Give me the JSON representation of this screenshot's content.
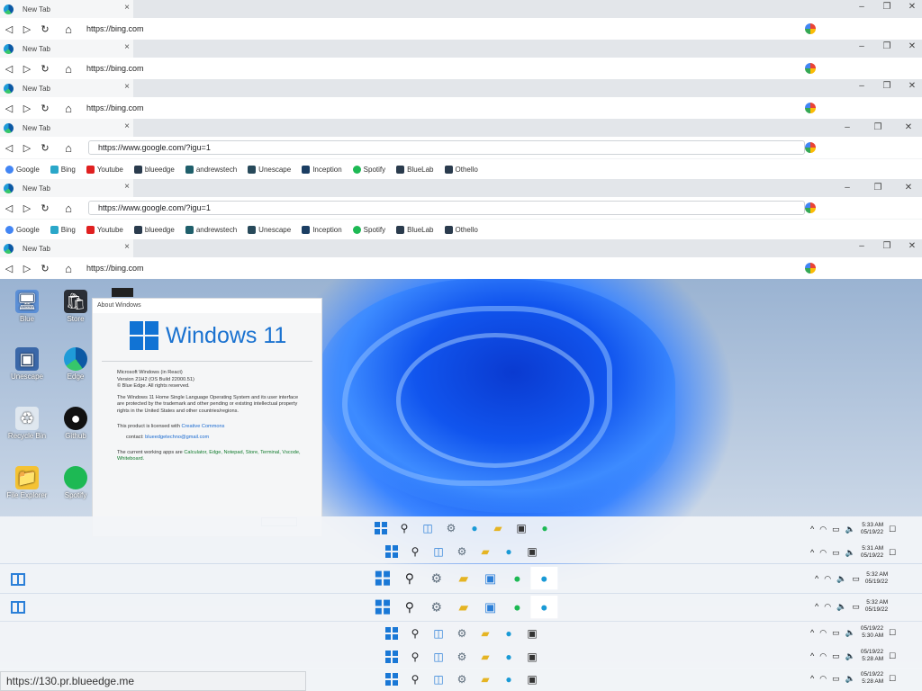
{
  "browser": {
    "tab_title": "New Tab",
    "tab_close": "×",
    "win_minimize": "–",
    "win_restore": "❐",
    "win_close": "✕",
    "nav_back": "◁",
    "nav_forward": "▷",
    "nav_refresh": "↻",
    "nav_home": "⌂",
    "url_bing": "https://bing.com",
    "url_google": "https://www.google.com/?igu=1",
    "bookmarks": [
      {
        "label": "Google",
        "color": "#4285f4"
      },
      {
        "label": "Bing",
        "color": "#2aa7c9"
      },
      {
        "label": "Youtube",
        "color": "#e02020"
      },
      {
        "label": "blueedge",
        "color": "#2a3b4d"
      },
      {
        "label": "andrewstech",
        "color": "#1f5f6b"
      },
      {
        "label": "Unescape",
        "color": "#27495a"
      },
      {
        "label": "Inception",
        "color": "#1b3e63"
      },
      {
        "label": "Spotify",
        "color": "#1db954"
      },
      {
        "label": "BlueLab",
        "color": "#2a3b4d"
      },
      {
        "label": "Othello",
        "color": "#2a3b4d"
      }
    ]
  },
  "desktop": {
    "icons": [
      {
        "label": "Blue"
      },
      {
        "label": "Store"
      },
      {
        "label": "Unescape"
      },
      {
        "label": "Edge"
      },
      {
        "label": "Recycle Bin"
      },
      {
        "label": "Github"
      },
      {
        "label": "File Explorer"
      },
      {
        "label": "Spotify"
      }
    ]
  },
  "about": {
    "window_title": "About Windows",
    "logo_text": "Windows 11",
    "line1": "Microsoft Windows (in React)",
    "line2": "Version 21H2 (OS Build 22000.51)",
    "line3": "© Blue Edge. All rights reserved.",
    "para": "The Windows 11 Home Single Language Operating System and its user interface are protected by the trademark and other pending or existing intellectual property rights in the United States and other countries/regions.",
    "license_prefix": "This product is licensed with ",
    "license_link": "Creative Commons",
    "contact_prefix": "contact: ",
    "contact_email": "blueedgetechno@gmail.com",
    "apps_prefix": "The current working apps are ",
    "apps_list": "Calculator, Edge, Notepad, Store, Terminal, Vscode, Whiteboard."
  },
  "taskbar": {
    "clocks": [
      {
        "time": "5:33 AM",
        "date": "05/19/22"
      },
      {
        "time": "5:31 AM",
        "date": "05/19/22"
      },
      {
        "time": "5:32 AM",
        "date": "05/19/22"
      },
      {
        "time": "5:32 AM",
        "date": "05/19/22"
      },
      {
        "time": "5:30 AM",
        "date": "05/19/22"
      },
      {
        "time": "5:28 AM",
        "date": "05/19/22"
      },
      {
        "time": "5:28 AM",
        "date": "05/19/22"
      }
    ],
    "tray_chevron": "^",
    "tray_wifi": "◠",
    "tray_battery": "▭",
    "tray_volume": "🔈",
    "notif": "☐"
  },
  "status_url": "https://130.pr.blueedge.me"
}
